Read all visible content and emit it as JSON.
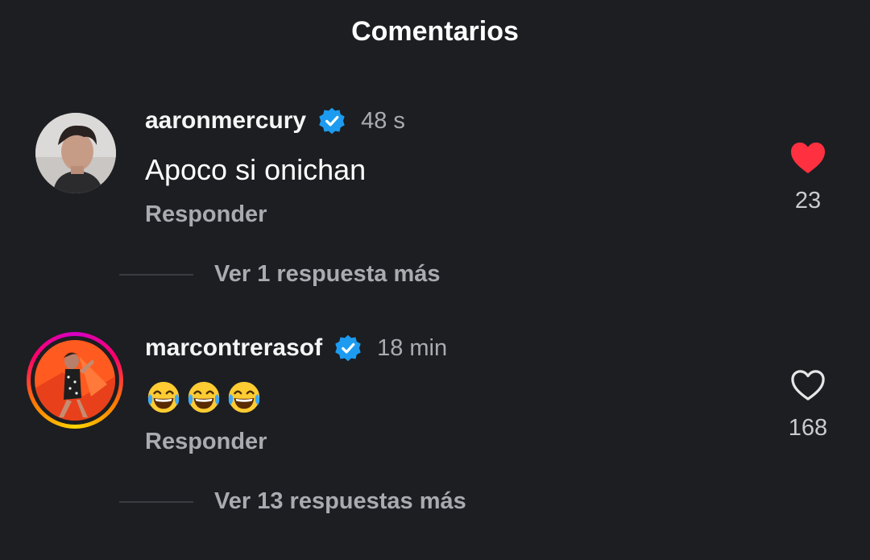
{
  "header": {
    "title": "Comentarios"
  },
  "comments": [
    {
      "username": "aaronmercury",
      "verified": true,
      "time": "48 s",
      "text": "Apoco si onichan",
      "reply_label": "Responder",
      "liked": true,
      "like_count": "23",
      "more_replies": "Ver 1 respuesta más",
      "avatar": "profile-photo-man-icon"
    },
    {
      "username": "marcontrerasof",
      "verified": true,
      "time": "18 min",
      "text": "😂😂😂",
      "reply_label": "Responder",
      "liked": false,
      "like_count": "168",
      "more_replies": "Ver 13 respuestas más",
      "avatar": "profile-photo-woman-orange-icon",
      "story_ring": true
    }
  ],
  "colors": {
    "background": "#1c1e22",
    "verified": "#1d9bf0",
    "like_active": "#ff3040",
    "secondary_text": "#a9abb0"
  }
}
